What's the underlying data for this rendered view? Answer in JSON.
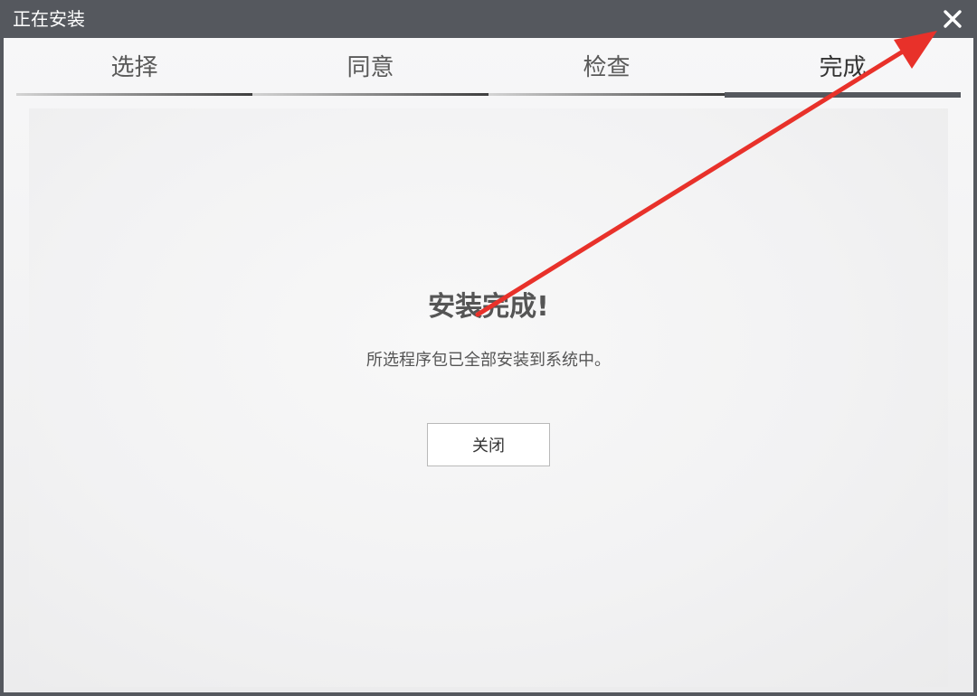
{
  "window": {
    "title": "正在安装",
    "close_icon": "close-icon"
  },
  "steps": [
    {
      "label": "选择",
      "active": false
    },
    {
      "label": "同意",
      "active": false
    },
    {
      "label": "检查",
      "active": false
    },
    {
      "label": "完成",
      "active": true
    }
  ],
  "content": {
    "heading": "安装完成!",
    "message": "所选程序包已全部安装到系统中。",
    "close_label": "关闭"
  },
  "colors": {
    "titlebar": "#55585e",
    "active_step_bar": "#55585e",
    "annotation_arrow": "#e8312a"
  },
  "annotation": {
    "icon": "red-arrow-icon"
  }
}
